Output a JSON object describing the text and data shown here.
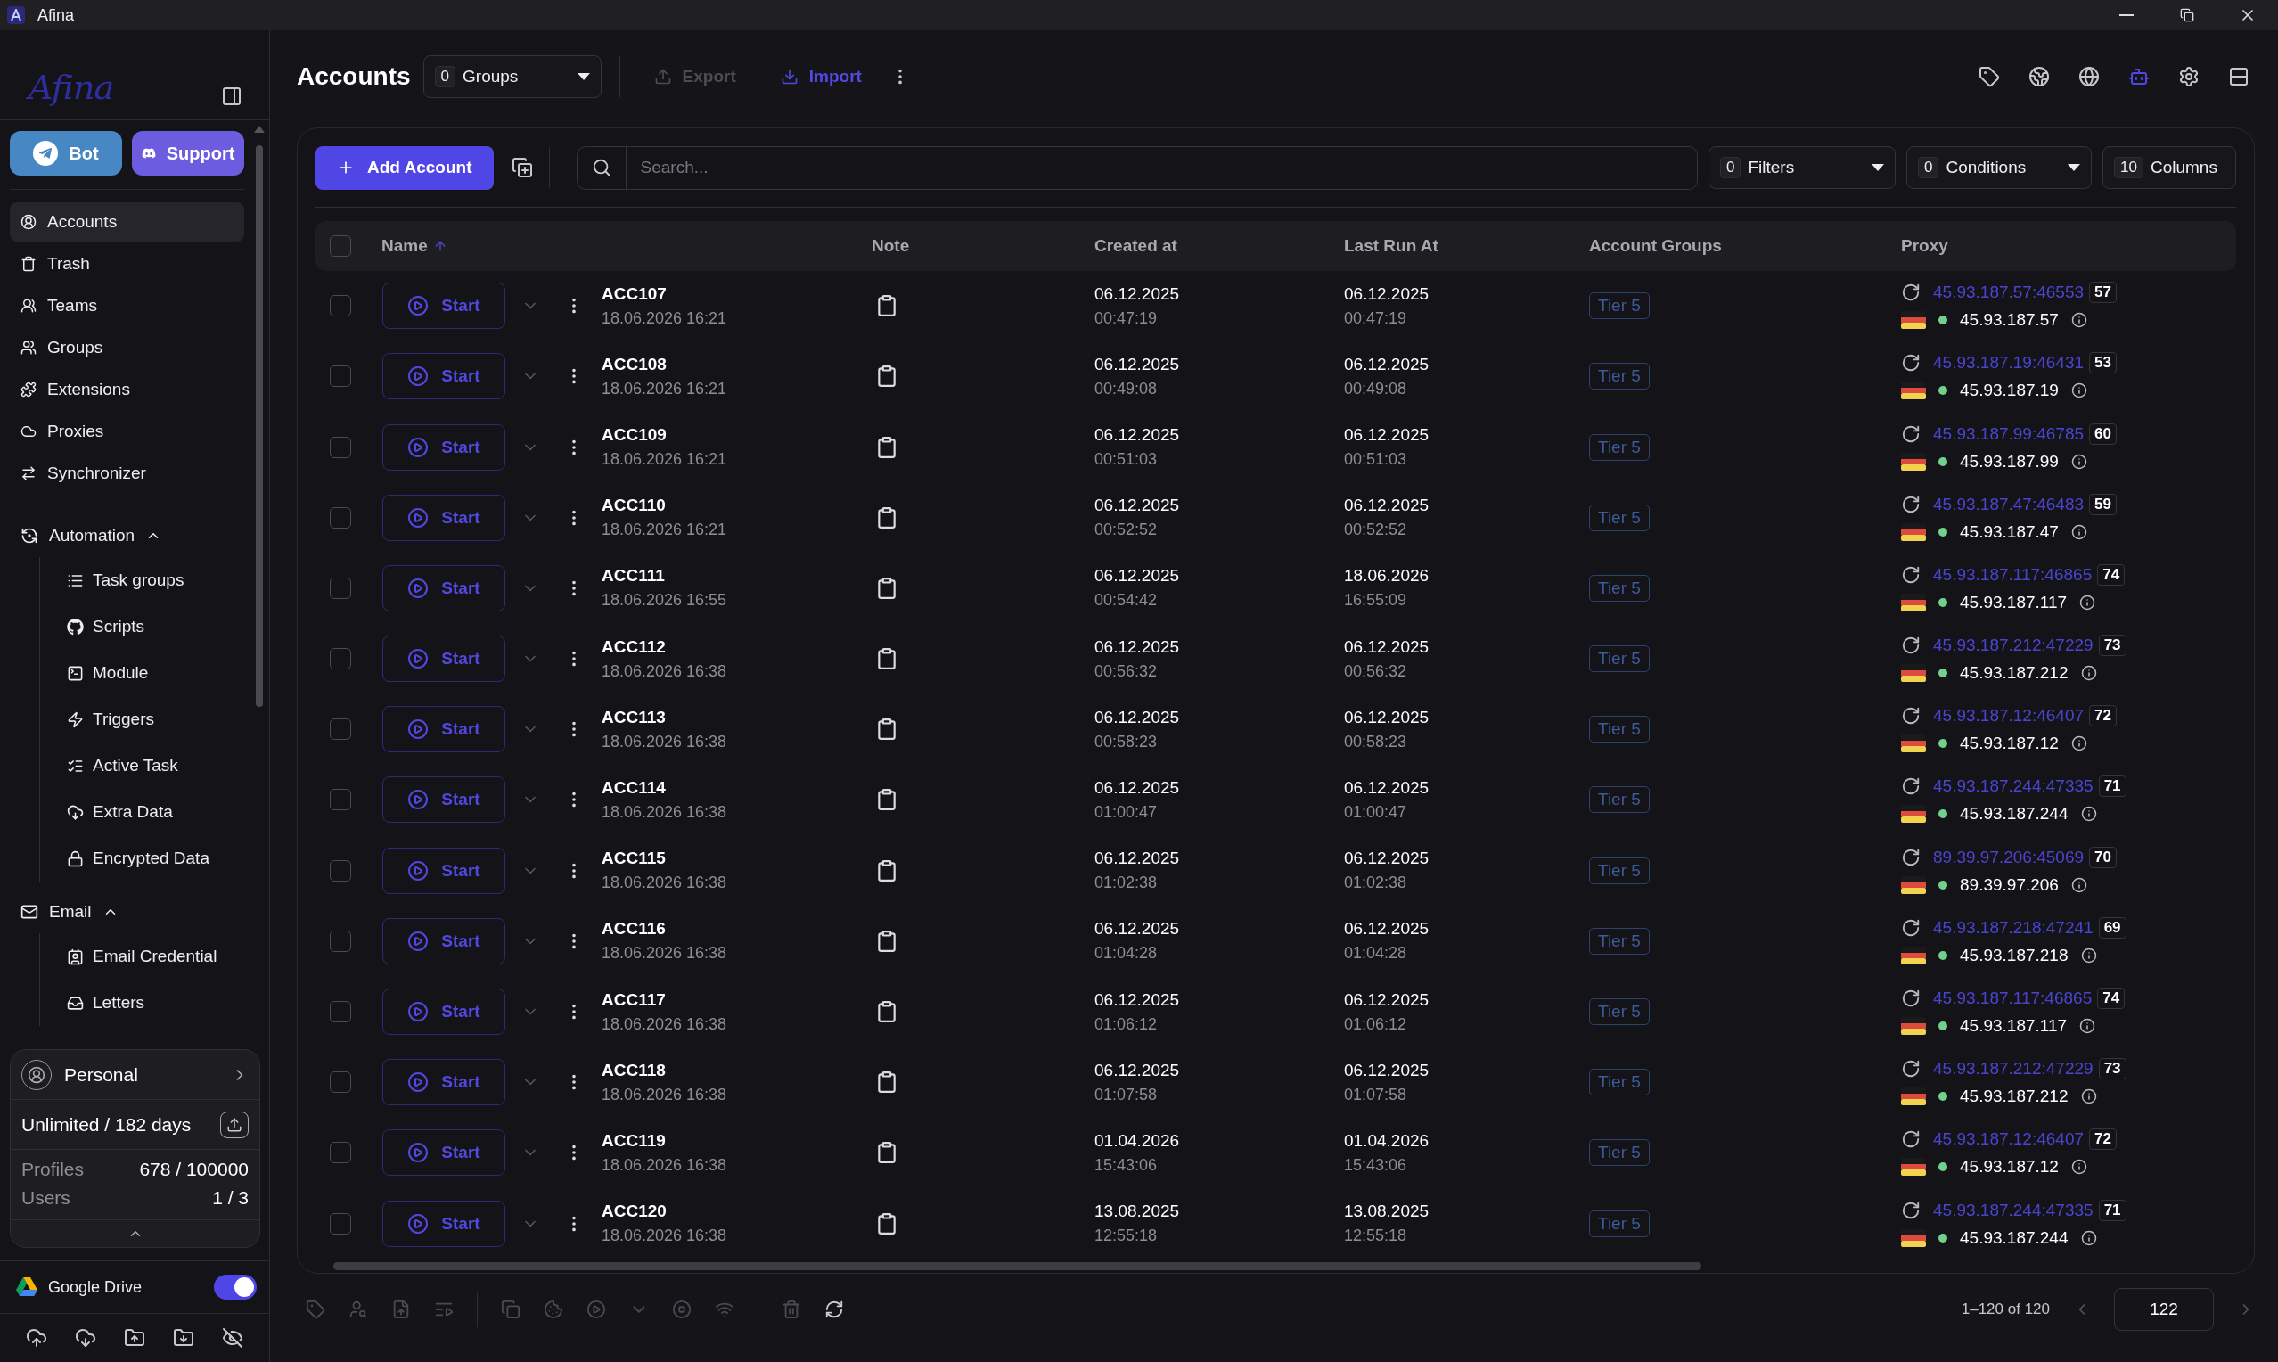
{
  "window": {
    "title": "Afina"
  },
  "sidebar": {
    "logo": "Afina",
    "buttons": [
      {
        "label": "Bot",
        "kind": "telegram"
      },
      {
        "label": "Support",
        "kind": "discord"
      }
    ],
    "nav": [
      {
        "label": "Accounts",
        "selected": true
      },
      {
        "label": "Trash",
        "selected": false
      },
      {
        "label": "Teams",
        "selected": false
      },
      {
        "label": "Groups",
        "selected": false
      },
      {
        "label": "Extensions",
        "selected": false
      },
      {
        "label": "Proxies",
        "selected": false
      },
      {
        "label": "Synchronizer",
        "selected": false
      }
    ],
    "sections": [
      {
        "label": "Automation",
        "expanded": true,
        "children": [
          {
            "label": "Task groups"
          },
          {
            "label": "Scripts"
          },
          {
            "label": "Module"
          },
          {
            "label": "Triggers"
          },
          {
            "label": "Active Task"
          },
          {
            "label": "Extra Data"
          },
          {
            "label": "Encrypted Data"
          }
        ]
      },
      {
        "label": "Email",
        "expanded": true,
        "children": [
          {
            "label": "Email Credential"
          },
          {
            "label": "Letters"
          }
        ]
      }
    ],
    "plan": {
      "name": "Personal",
      "term": "Unlimited / 182 days",
      "stats": [
        {
          "label": "Profiles",
          "value": "678 / 100000"
        },
        {
          "label": "Users",
          "value": "1 / 3"
        }
      ]
    },
    "google_drive": {
      "label": "Google Drive",
      "on": true
    }
  },
  "header": {
    "title": "Accounts",
    "groups": {
      "count": "0",
      "label": "Groups"
    },
    "actions": [
      {
        "label": "Export",
        "disabled": true
      },
      {
        "label": "Import",
        "disabled": false
      }
    ],
    "tools": [
      {
        "selected": false
      },
      {
        "selected": false
      },
      {
        "selected": false
      },
      {
        "selected": true
      },
      {
        "selected": false
      },
      {
        "selected": false
      }
    ]
  },
  "toolbar": {
    "add_label": "Add Account",
    "search": {
      "placeholder": "Search..."
    },
    "selectors": [
      {
        "count": "0",
        "label": "Filters",
        "dropdown": true
      },
      {
        "count": "0",
        "label": "Conditions",
        "dropdown": true
      },
      {
        "count": "10",
        "label": "Columns",
        "dropdown": false
      }
    ]
  },
  "table": {
    "select_all": {
      "checked": false
    },
    "columns": [
      {
        "label": "Name",
        "sorted": true
      },
      {
        "label": "Note",
        "sorted": false
      },
      {
        "label": "Created at",
        "sorted": false
      },
      {
        "label": "Last Run At",
        "sorted": false
      },
      {
        "label": "Account Groups",
        "sorted": false
      },
      {
        "label": "Proxy",
        "sorted": false
      }
    ],
    "rows": [
      {
        "checked": false,
        "action": "Start",
        "name": "ACC107",
        "updated": "18.06.2026 16:21",
        "created_date": "06.12.2025",
        "created_time": "00:47:19",
        "run_date": "06.12.2025",
        "run_time": "00:47:19",
        "groups": [
          "Tier 5"
        ],
        "proxy": "45.93.187.57:46553",
        "score": "57",
        "ip": "45.93.187.57"
      },
      {
        "checked": false,
        "action": "Start",
        "name": "ACC108",
        "updated": "18.06.2026 16:21",
        "created_date": "06.12.2025",
        "created_time": "00:49:08",
        "run_date": "06.12.2025",
        "run_time": "00:49:08",
        "groups": [
          "Tier 5"
        ],
        "proxy": "45.93.187.19:46431",
        "score": "53",
        "ip": "45.93.187.19"
      },
      {
        "checked": false,
        "action": "Start",
        "name": "ACC109",
        "updated": "18.06.2026 16:21",
        "created_date": "06.12.2025",
        "created_time": "00:51:03",
        "run_date": "06.12.2025",
        "run_time": "00:51:03",
        "groups": [
          "Tier 5"
        ],
        "proxy": "45.93.187.99:46785",
        "score": "60",
        "ip": "45.93.187.99"
      },
      {
        "checked": false,
        "action": "Start",
        "name": "ACC110",
        "updated": "18.06.2026 16:21",
        "created_date": "06.12.2025",
        "created_time": "00:52:52",
        "run_date": "06.12.2025",
        "run_time": "00:52:52",
        "groups": [
          "Tier 5"
        ],
        "proxy": "45.93.187.47:46483",
        "score": "59",
        "ip": "45.93.187.47"
      },
      {
        "checked": false,
        "action": "Start",
        "name": "ACC111",
        "updated": "18.06.2026 16:55",
        "created_date": "06.12.2025",
        "created_time": "00:54:42",
        "run_date": "18.06.2026",
        "run_time": "16:55:09",
        "groups": [
          "Tier 5"
        ],
        "proxy": "45.93.187.117:46865",
        "score": "74",
        "ip": "45.93.187.117"
      },
      {
        "checked": false,
        "action": "Start",
        "name": "ACC112",
        "updated": "18.06.2026 16:38",
        "created_date": "06.12.2025",
        "created_time": "00:56:32",
        "run_date": "06.12.2025",
        "run_time": "00:56:32",
        "groups": [
          "Tier 5"
        ],
        "proxy": "45.93.187.212:47229",
        "score": "73",
        "ip": "45.93.187.212"
      },
      {
        "checked": false,
        "action": "Start",
        "name": "ACC113",
        "updated": "18.06.2026 16:38",
        "created_date": "06.12.2025",
        "created_time": "00:58:23",
        "run_date": "06.12.2025",
        "run_time": "00:58:23",
        "groups": [
          "Tier 5"
        ],
        "proxy": "45.93.187.12:46407",
        "score": "72",
        "ip": "45.93.187.12"
      },
      {
        "checked": false,
        "action": "Start",
        "name": "ACC114",
        "updated": "18.06.2026 16:38",
        "created_date": "06.12.2025",
        "created_time": "01:00:47",
        "run_date": "06.12.2025",
        "run_time": "01:00:47",
        "groups": [
          "Tier 5"
        ],
        "proxy": "45.93.187.244:47335",
        "score": "71",
        "ip": "45.93.187.244"
      },
      {
        "checked": false,
        "action": "Start",
        "name": "ACC115",
        "updated": "18.06.2026 16:38",
        "created_date": "06.12.2025",
        "created_time": "01:02:38",
        "run_date": "06.12.2025",
        "run_time": "01:02:38",
        "groups": [
          "Tier 5"
        ],
        "proxy": "89.39.97.206:45069",
        "score": "70",
        "ip": "89.39.97.206"
      },
      {
        "checked": false,
        "action": "Start",
        "name": "ACC116",
        "updated": "18.06.2026 16:38",
        "created_date": "06.12.2025",
        "created_time": "01:04:28",
        "run_date": "06.12.2025",
        "run_time": "01:04:28",
        "groups": [
          "Tier 5"
        ],
        "proxy": "45.93.187.218:47241",
        "score": "69",
        "ip": "45.93.187.218"
      },
      {
        "checked": false,
        "action": "Start",
        "name": "ACC117",
        "updated": "18.06.2026 16:38",
        "created_date": "06.12.2025",
        "created_time": "01:06:12",
        "run_date": "06.12.2025",
        "run_time": "01:06:12",
        "groups": [
          "Tier 5"
        ],
        "proxy": "45.93.187.117:46865",
        "score": "74",
        "ip": "45.93.187.117"
      },
      {
        "checked": false,
        "action": "Start",
        "name": "ACC118",
        "updated": "18.06.2026 16:38",
        "created_date": "06.12.2025",
        "created_time": "01:07:58",
        "run_date": "06.12.2025",
        "run_time": "01:07:58",
        "groups": [
          "Tier 5"
        ],
        "proxy": "45.93.187.212:47229",
        "score": "73",
        "ip": "45.93.187.212"
      },
      {
        "checked": false,
        "action": "Start",
        "name": "ACC119",
        "updated": "18.06.2026 16:38",
        "created_date": "01.04.2026",
        "created_time": "15:43:06",
        "run_date": "01.04.2026",
        "run_time": "15:43:06",
        "groups": [
          "Tier 5"
        ],
        "proxy": "45.93.187.12:46407",
        "score": "72",
        "ip": "45.93.187.12"
      },
      {
        "checked": false,
        "action": "Start",
        "name": "ACC120",
        "updated": "18.06.2026 16:38",
        "created_date": "13.08.2025",
        "created_time": "12:55:18",
        "run_date": "13.08.2025",
        "run_time": "12:55:18",
        "groups": [
          "Tier 5"
        ],
        "proxy": "45.93.187.244:47335",
        "score": "71",
        "ip": "45.93.187.244"
      }
    ]
  },
  "footer": {
    "bulk_actions": [
      {
        "disabled": true
      },
      {
        "disabled": true
      },
      {
        "disabled": true
      },
      {
        "disabled": true
      },
      {
        "disabled": true
      },
      {
        "disabled": true
      },
      {
        "disabled": true
      },
      {
        "disabled": true
      },
      {
        "disabled": true
      },
      {
        "disabled": true
      },
      {
        "disabled": true
      },
      {
        "disabled": false
      }
    ],
    "range": "1–120 of 120",
    "page": "122"
  }
}
